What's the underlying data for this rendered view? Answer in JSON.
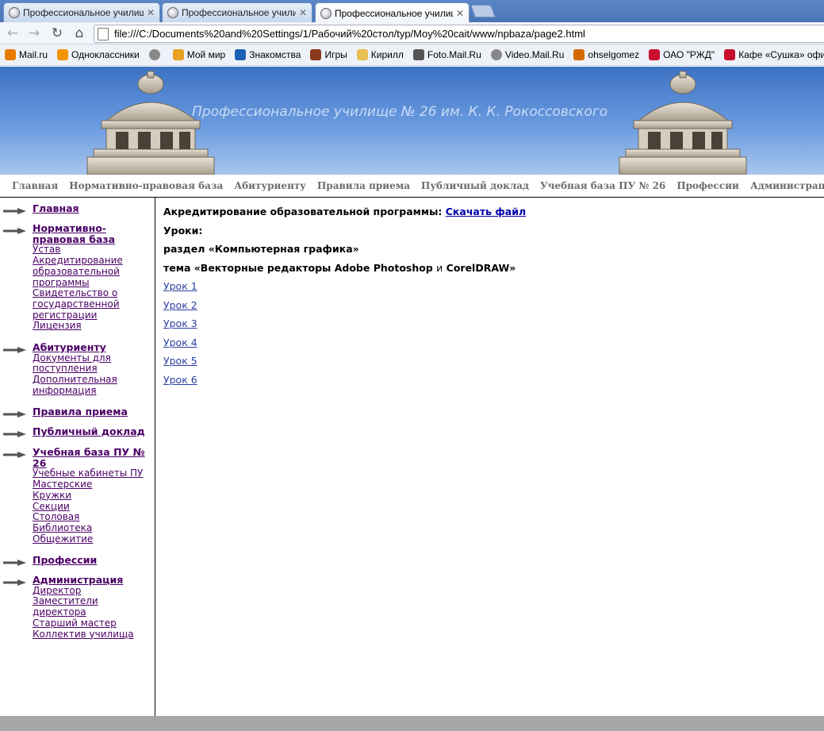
{
  "tabs": [
    {
      "title": "Профессиональное училище",
      "active": false
    },
    {
      "title": "Профессиональное училище",
      "active": false
    },
    {
      "title": "Профессиональное училище",
      "active": true
    }
  ],
  "address": "file:///C:/Documents%20and%20Settings/1/Рабочий%20стол/typ/Moy%20cait/www/npbaza/page2.html",
  "bookmarks": [
    {
      "label": "Mail.ru",
      "icon": "mailru-icon",
      "color": "#e87c00"
    },
    {
      "label": "Одноклассники",
      "icon": "odnoklassniki-icon",
      "color": "#f29400"
    },
    {
      "label": "",
      "icon": "globe-icon",
      "color": "#888888"
    },
    {
      "label": "Мой мир",
      "icon": "moimir-icon",
      "color": "#e8a020"
    },
    {
      "label": "Знакомства",
      "icon": "at-icon",
      "color": "#1d62b4"
    },
    {
      "label": "Игры",
      "icon": "games-icon",
      "color": "#8b3a1f"
    },
    {
      "label": "Кирилл",
      "icon": "folder-icon",
      "color": "#e8c052"
    },
    {
      "label": "Foto.Mail.Ru",
      "icon": "camera-icon",
      "color": "#555555"
    },
    {
      "label": "Video.Mail.Ru",
      "icon": "globe-icon",
      "color": "#888888"
    },
    {
      "label": "ohselgomez",
      "icon": "formspring-icon",
      "color": "#d46a00"
    },
    {
      "label": "ОАО \"РЖД\"",
      "icon": "rzd-icon",
      "color": "#c8102e"
    },
    {
      "label": "Кафе «Сушка» офиц...",
      "icon": "cafe-icon",
      "color": "#c8102e"
    }
  ],
  "site_title": "Профессиональное училище № 26 им. К. К. Рокоссовского",
  "top_nav": [
    "Главная",
    "Нормативно-правовая база",
    "Абитуриенту",
    "Правила приема",
    "Публичный доклад",
    "Учебная база ПУ № 26",
    "Профессии",
    "Администрация"
  ],
  "sidebar": [
    {
      "title": "Главная",
      "links": []
    },
    {
      "title": "Нормативно-правовая база",
      "links": [
        "Устав",
        "Акредитирование",
        "образовательной",
        "программы",
        "Свидетельство о",
        "государственной",
        "регистрации",
        "Лицензия"
      ]
    },
    {
      "title": "Абитуриенту",
      "links": [
        "Документы для",
        "поступления",
        "Дополнительная",
        "информация"
      ]
    },
    {
      "title": "Правила приема",
      "links": []
    },
    {
      "title": "Публичный доклад",
      "links": []
    },
    {
      "title": "Учебная база ПУ № 26",
      "links": [
        "Учебные кабинеты ПУ",
        "Мастерские",
        "Кружки",
        "Секции",
        "Столовая",
        "Библиотека",
        "Общежитие"
      ]
    },
    {
      "title": "Профессии",
      "links": []
    },
    {
      "title": "Администрация",
      "links": [
        "Директор",
        "Заместители",
        "директора",
        "Старший мастер",
        "Коллектив училища"
      ]
    }
  ],
  "content": {
    "accreditation_label": "Акредитирование образовательной программы:",
    "download_link": "Скачать файл",
    "lessons_heading": "Уроки:",
    "section": "раздел «Компьютерная графика»",
    "topic_prefix": "тема «Векторные редакторы Adobe Photoshop",
    "topic_and": "и",
    "topic_suffix": "CorelDRAW»",
    "lessons": [
      "Урок 1",
      "Урок 2",
      "Урок 3",
      "Урок 4",
      "Урок 5",
      "Урок 6"
    ]
  }
}
